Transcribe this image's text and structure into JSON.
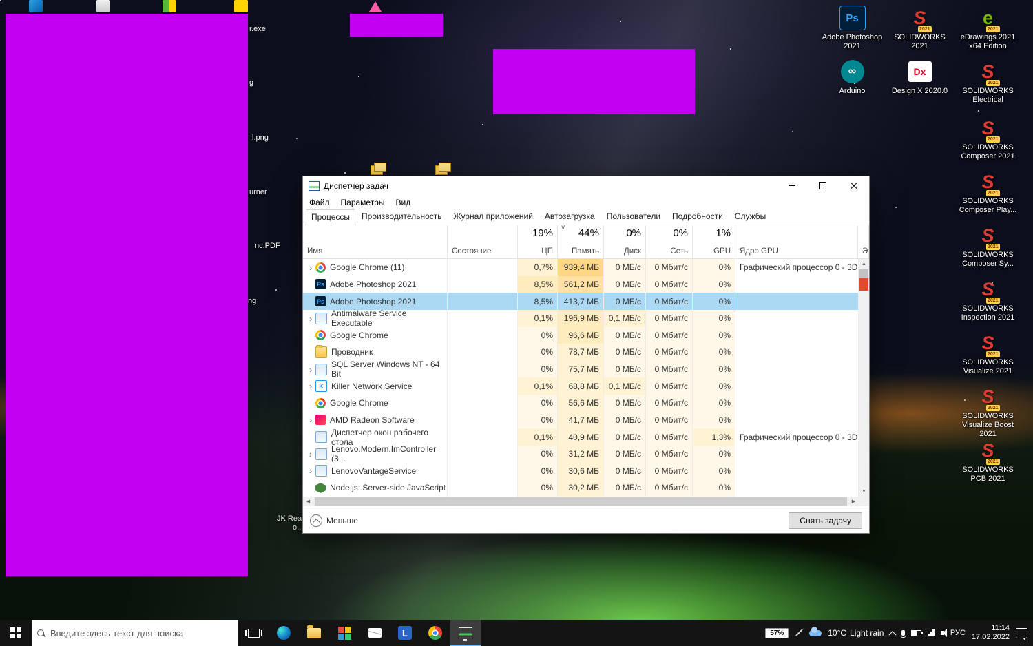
{
  "colors": {
    "magenta_overlay": "#c400f2",
    "selected_row": "#abd9f3",
    "heat_palette": [
      "#fff8e8",
      "#fff3d4",
      "#ffecbe",
      "#ffe2a3",
      "#ffd685"
    ],
    "taskbar_bg": "#141414"
  },
  "desktop": {
    "label_fragments": [
      "r.exe",
      "g",
      "l.png",
      "urner",
      "nc.PDF",
      "ng",
      "JK Rear I",
      "o..."
    ],
    "icons": [
      {
        "label": "Adobe Photoshop 2021",
        "kind": "ps",
        "glyph": "Ps",
        "badge": ""
      },
      {
        "label": "SOLIDWORKS 2021",
        "kind": "sw",
        "glyph": "S",
        "badge": "2021"
      },
      {
        "label": "eDrawings 2021 x64 Edition",
        "kind": "edrw",
        "glyph": "e",
        "badge": "2021"
      },
      {
        "label": "Arduino",
        "kind": "arduino",
        "glyph": "∞",
        "badge": ""
      },
      {
        "label": "Design X 2020.0",
        "kind": "dx",
        "glyph": "Dx",
        "badge": ""
      },
      {
        "label": "SOLIDWORKS Electrical",
        "kind": "sw",
        "glyph": "S",
        "badge": "2021"
      },
      {
        "label": "SOLIDWORKS Composer 2021",
        "kind": "sw",
        "glyph": "S",
        "badge": "2021"
      },
      {
        "label": "SOLIDWORKS Composer Play...",
        "kind": "sw",
        "glyph": "S",
        "badge": "2021"
      },
      {
        "label": "SOLIDWORKS Composer Sy...",
        "kind": "sw",
        "glyph": "S",
        "badge": "2021"
      },
      {
        "label": "SOLIDWORKS Inspection 2021",
        "kind": "sw",
        "glyph": "S",
        "badge": "2021"
      },
      {
        "label": "SOLIDWORKS Visualize 2021",
        "kind": "sw",
        "glyph": "S",
        "badge": "2021"
      },
      {
        "label": "SOLIDWORKS Visualize Boost 2021",
        "kind": "sw",
        "glyph": "S",
        "badge": "2021"
      },
      {
        "label": "SOLIDWORKS PCB 2021",
        "kind": "sw",
        "glyph": "S",
        "badge": "2021"
      }
    ]
  },
  "task_manager": {
    "title": "Диспетчер задач",
    "menu": [
      "Файл",
      "Параметры",
      "Вид"
    ],
    "tabs": [
      {
        "label": "Процессы",
        "active": true
      },
      {
        "label": "Производительность",
        "active": false
      },
      {
        "label": "Журнал приложений",
        "active": false
      },
      {
        "label": "Автозагрузка",
        "active": false
      },
      {
        "label": "Пользователи",
        "active": false
      },
      {
        "label": "Подробности",
        "active": false
      },
      {
        "label": "Службы",
        "active": false
      }
    ],
    "header": {
      "name": "Имя",
      "status": "Состояние",
      "cpu_pct": "19%",
      "cpu": "ЦП",
      "mem_pct": "44%",
      "mem": "Память",
      "disk_pct": "0%",
      "disk": "Диск",
      "net_pct": "0%",
      "net": "Сеть",
      "gpu_pct": "1%",
      "gpu": "GPU",
      "engine": "Ядро GPU",
      "power_cut": "Э",
      "sort_glyph": "∨"
    },
    "rows": [
      {
        "name": "Google Chrome (11)",
        "icon": "chrome",
        "glyph": "",
        "expand": true,
        "cpu": "0,7%",
        "cpu_h": 1,
        "mem": "939,4 МБ",
        "mem_h": 4,
        "disk": "0 МБ/с",
        "disk_h": 0,
        "net": "0 Мбит/с",
        "net_h": 0,
        "gpu": "0%",
        "gpu_h": 0,
        "engine": "Графический процессор 0 - 3D",
        "selected": false
      },
      {
        "name": "Adobe Photoshop 2021",
        "icon": "ps",
        "glyph": "Ps",
        "expand": false,
        "cpu": "8,5%",
        "cpu_h": 2,
        "mem": "561,2 МБ",
        "mem_h": 3,
        "disk": "0 МБ/с",
        "disk_h": 0,
        "net": "0 Мбит/с",
        "net_h": 0,
        "gpu": "0%",
        "gpu_h": 0,
        "engine": "",
        "selected": false
      },
      {
        "name": "Adobe Photoshop 2021",
        "icon": "ps",
        "glyph": "Ps",
        "expand": false,
        "cpu": "8,5%",
        "cpu_h": 2,
        "mem": "413,7 МБ",
        "mem_h": 3,
        "disk": "0 МБ/с",
        "disk_h": 0,
        "net": "0 Мбит/с",
        "net_h": 0,
        "gpu": "0%",
        "gpu_h": 0,
        "engine": "",
        "selected": true
      },
      {
        "name": "Antimalware Service Executable",
        "icon": "win",
        "glyph": "",
        "expand": true,
        "cpu": "0,1%",
        "cpu_h": 1,
        "mem": "196,9 МБ",
        "mem_h": 2,
        "disk": "0,1 МБ/с",
        "disk_h": 1,
        "net": "0 Мбит/с",
        "net_h": 0,
        "gpu": "0%",
        "gpu_h": 0,
        "engine": "",
        "selected": false
      },
      {
        "name": "Google Chrome",
        "icon": "chrome",
        "glyph": "",
        "expand": false,
        "cpu": "0%",
        "cpu_h": 0,
        "mem": "96,6 МБ",
        "mem_h": 2,
        "disk": "0 МБ/с",
        "disk_h": 0,
        "net": "0 Мбит/с",
        "net_h": 0,
        "gpu": "0%",
        "gpu_h": 0,
        "engine": "",
        "selected": false
      },
      {
        "name": "Проводник",
        "icon": "folder",
        "glyph": "",
        "expand": false,
        "cpu": "0%",
        "cpu_h": 0,
        "mem": "78,7 МБ",
        "mem_h": 1,
        "disk": "0 МБ/с",
        "disk_h": 0,
        "net": "0 Мбит/с",
        "net_h": 0,
        "gpu": "0%",
        "gpu_h": 0,
        "engine": "",
        "selected": false
      },
      {
        "name": "SQL Server Windows NT - 64 Bit",
        "icon": "win",
        "glyph": "",
        "expand": true,
        "cpu": "0%",
        "cpu_h": 0,
        "mem": "75,7 МБ",
        "mem_h": 1,
        "disk": "0 МБ/с",
        "disk_h": 0,
        "net": "0 Мбит/с",
        "net_h": 0,
        "gpu": "0%",
        "gpu_h": 0,
        "engine": "",
        "selected": false
      },
      {
        "name": "Killer Network Service",
        "icon": "k",
        "glyph": "K",
        "expand": true,
        "cpu": "0,1%",
        "cpu_h": 1,
        "mem": "68,8 МБ",
        "mem_h": 1,
        "disk": "0,1 МБ/с",
        "disk_h": 1,
        "net": "0 Мбит/с",
        "net_h": 0,
        "gpu": "0%",
        "gpu_h": 0,
        "engine": "",
        "selected": false
      },
      {
        "name": "Google Chrome",
        "icon": "chrome",
        "glyph": "",
        "expand": false,
        "cpu": "0%",
        "cpu_h": 0,
        "mem": "56,6 МБ",
        "mem_h": 1,
        "disk": "0 МБ/с",
        "disk_h": 0,
        "net": "0 Мбит/с",
        "net_h": 0,
        "gpu": "0%",
        "gpu_h": 0,
        "engine": "",
        "selected": false
      },
      {
        "name": "AMD Radeon Software",
        "icon": "amd",
        "glyph": "",
        "expand": true,
        "cpu": "0%",
        "cpu_h": 0,
        "mem": "41,7 МБ",
        "mem_h": 1,
        "disk": "0 МБ/с",
        "disk_h": 0,
        "net": "0 Мбит/с",
        "net_h": 0,
        "gpu": "0%",
        "gpu_h": 0,
        "engine": "",
        "selected": false
      },
      {
        "name": "Диспетчер окон рабочего стола",
        "icon": "win",
        "glyph": "",
        "expand": false,
        "cpu": "0,1%",
        "cpu_h": 1,
        "mem": "40,9 МБ",
        "mem_h": 1,
        "disk": "0 МБ/с",
        "disk_h": 0,
        "net": "0 Мбит/с",
        "net_h": 0,
        "gpu": "1,3%",
        "gpu_h": 1,
        "engine": "Графический процессор 0 - 3D",
        "selected": false
      },
      {
        "name": "Lenovo.Modern.ImController (3...",
        "icon": "win",
        "glyph": "",
        "expand": true,
        "cpu": "0%",
        "cpu_h": 0,
        "mem": "31,2 МБ",
        "mem_h": 1,
        "disk": "0 МБ/с",
        "disk_h": 0,
        "net": "0 Мбит/с",
        "net_h": 0,
        "gpu": "0%",
        "gpu_h": 0,
        "engine": "",
        "selected": false
      },
      {
        "name": "LenovoVantageService",
        "icon": "win",
        "glyph": "",
        "expand": true,
        "cpu": "0%",
        "cpu_h": 0,
        "mem": "30,6 МБ",
        "mem_h": 1,
        "disk": "0 МБ/с",
        "disk_h": 0,
        "net": "0 Мбит/с",
        "net_h": 0,
        "gpu": "0%",
        "gpu_h": 0,
        "engine": "",
        "selected": false
      },
      {
        "name": "Node.js: Server-side JavaScript",
        "icon": "node",
        "glyph": "",
        "expand": false,
        "cpu": "0%",
        "cpu_h": 0,
        "mem": "30,2 МБ",
        "mem_h": 1,
        "disk": "0 МБ/с",
        "disk_h": 0,
        "net": "0 Мбит/с",
        "net_h": 0,
        "gpu": "0%",
        "gpu_h": 0,
        "engine": "",
        "selected": false
      }
    ],
    "footer": {
      "less_label": "Меньше",
      "end_task_label": "Снять задачу"
    }
  },
  "taskbar": {
    "search_placeholder": "Введите здесь текст для поиска",
    "lenovo_glyph": "L",
    "battery_percent": "57%",
    "temperature": "10°C",
    "condition": "Light rain",
    "lang": "РУС",
    "time": "11:14",
    "date": "17.02.2022"
  }
}
